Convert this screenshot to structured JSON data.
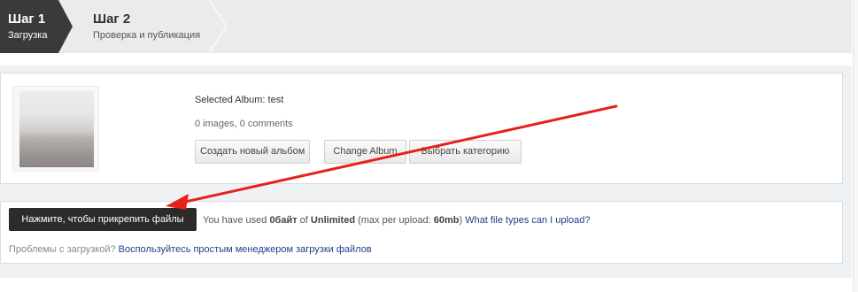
{
  "steps": [
    {
      "title": "Шаг 1",
      "subtitle": "Загрузка",
      "active": true
    },
    {
      "title": "Шаг 2",
      "subtitle": "Проверка и публикация",
      "active": false
    }
  ],
  "album": {
    "selected_label": "Selected Album: test",
    "stats": "0 images, 0 comments",
    "buttons": {
      "create": "Создать новый альбом",
      "change": "Change Album",
      "category": "Выбрать категорию"
    }
  },
  "upload": {
    "attach_button": "Нажмите, чтобы прикрепить файлы",
    "used_prefix": "You have used ",
    "used_amount": "0байт",
    "of_text": " of ",
    "limit": "Unlimited",
    "max_prefix": " (max per upload: ",
    "max_value": "60mb",
    "max_suffix": ") ",
    "filetypes_link": "What file types can I upload?",
    "problems_text": "Проблемы с загрузкой? ",
    "simple_manager_link": "Воспользуйтесь простым менеджером загрузки файлов"
  },
  "colors": {
    "active_step_bg": "#3a3a3a",
    "steps_bg": "#ebebeb",
    "attach_button_bg": "#2b2b2b",
    "link": "#1f3f8a",
    "annotation_arrow": "#e8201c"
  }
}
